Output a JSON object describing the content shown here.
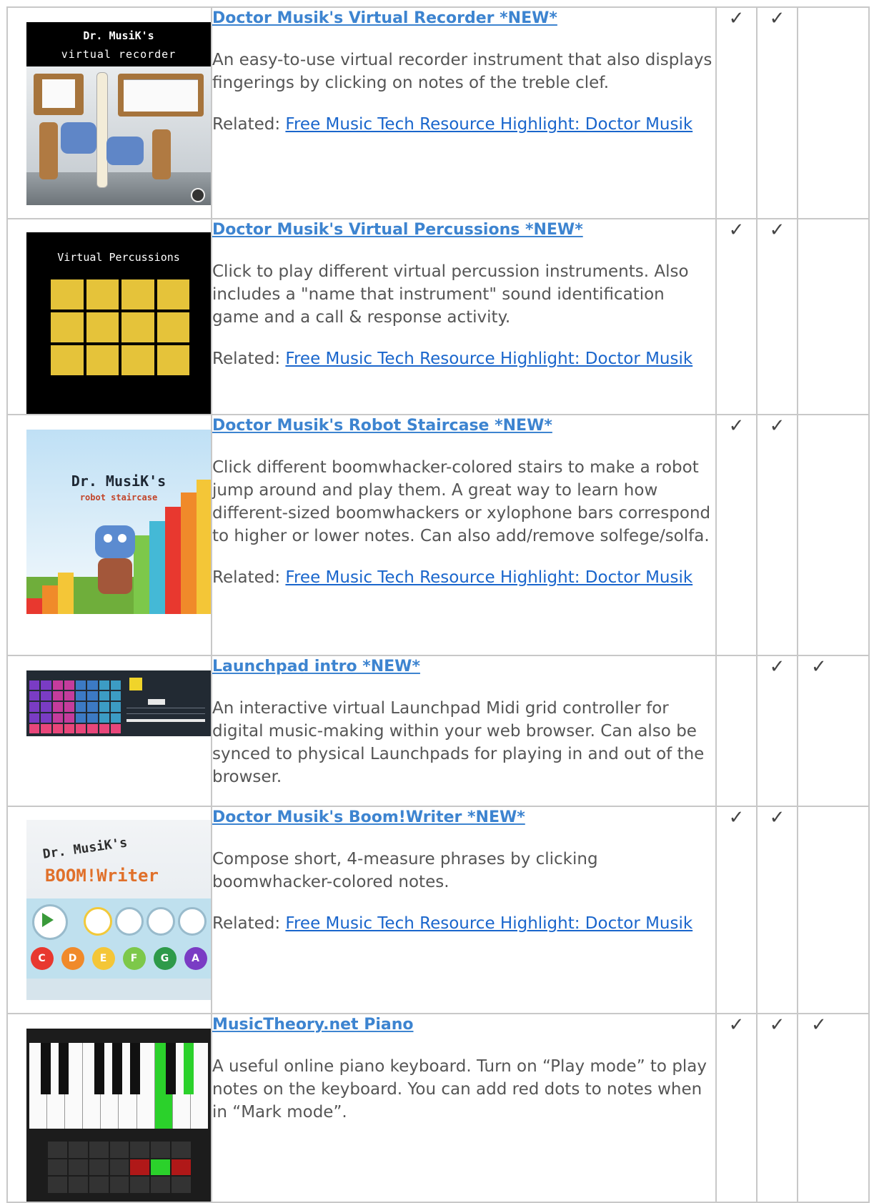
{
  "rows": [
    {
      "title": "Doctor Musik's Virtual Recorder *NEW*",
      "description": "An easy-to-use virtual recorder instrument that also displays fingerings by clicking on notes of the treble clef.",
      "related_label": "Related:",
      "related_link": "Free Music Tech Resource Highlight: Doctor Musik",
      "checks": [
        "✓",
        "✓",
        ""
      ],
      "thumb": {
        "line1": "Dr. MusiK's",
        "line2": "virtual recorder"
      }
    },
    {
      "title": "Doctor Musik's Virtual Percussions *NEW*",
      "description": "Click to play different virtual percussion instruments. Also includes a \"name that instrument\" sound identification game and a call & response activity.",
      "related_label": "Related:",
      "related_link": "Free Music Tech Resource Highlight: Doctor Musik",
      "checks": [
        "✓",
        "✓",
        ""
      ],
      "thumb": {
        "line1": "Virtual Percussions"
      }
    },
    {
      "title": "Doctor Musik's Robot Staircase *NEW*",
      "description": "Click different boomwhacker-colored stairs to make a robot jump around and play them. A great way to learn how different-sized boomwhackers or xylophone bars correspond to higher or lower notes. Can also add/remove solfege/solfa.",
      "related_label": "Related:",
      "related_link": "Free Music Tech Resource Highlight: Doctor Musik",
      "checks": [
        "✓",
        "✓",
        ""
      ],
      "thumb": {
        "line1": "Dr. MusiK's",
        "line2": "robot staircase"
      }
    },
    {
      "title": "Launchpad intro *NEW*",
      "description": "An interactive virtual Launchpad Midi grid controller for digital music-making within your web browser. Can also be synced to physical Launchpads for playing in and out of the browser.",
      "related_label": "",
      "related_link": "",
      "checks": [
        "",
        "✓",
        "✓"
      ],
      "thumb": {}
    },
    {
      "title": "Doctor Musik's Boom!Writer *NEW*",
      "description": "Compose short, 4-measure phrases by clicking boomwhacker-colored notes.",
      "related_label": "Related:",
      "related_link": "Free Music Tech Resource Highlight: Doctor Musik",
      "checks": [
        "✓",
        "✓",
        ""
      ],
      "thumb": {
        "line1": "Dr. MusiK's",
        "line2": "BOOM!Writer",
        "notes": [
          "C",
          "D",
          "E",
          "F",
          "G",
          "A"
        ]
      }
    },
    {
      "title": "MusicTheory.net Piano",
      "description": "A useful online piano keyboard. Turn on “Play mode” to play notes on the keyboard. You can add red dots to notes when in “Mark mode”.",
      "related_label": "",
      "related_link": "",
      "checks": [
        "✓",
        "✓",
        "✓"
      ],
      "thumb": {}
    }
  ],
  "colors": {
    "link": "#3d84d0",
    "related_link": "#1a66cc",
    "border": "#c8c8c8",
    "text": "#555555"
  }
}
